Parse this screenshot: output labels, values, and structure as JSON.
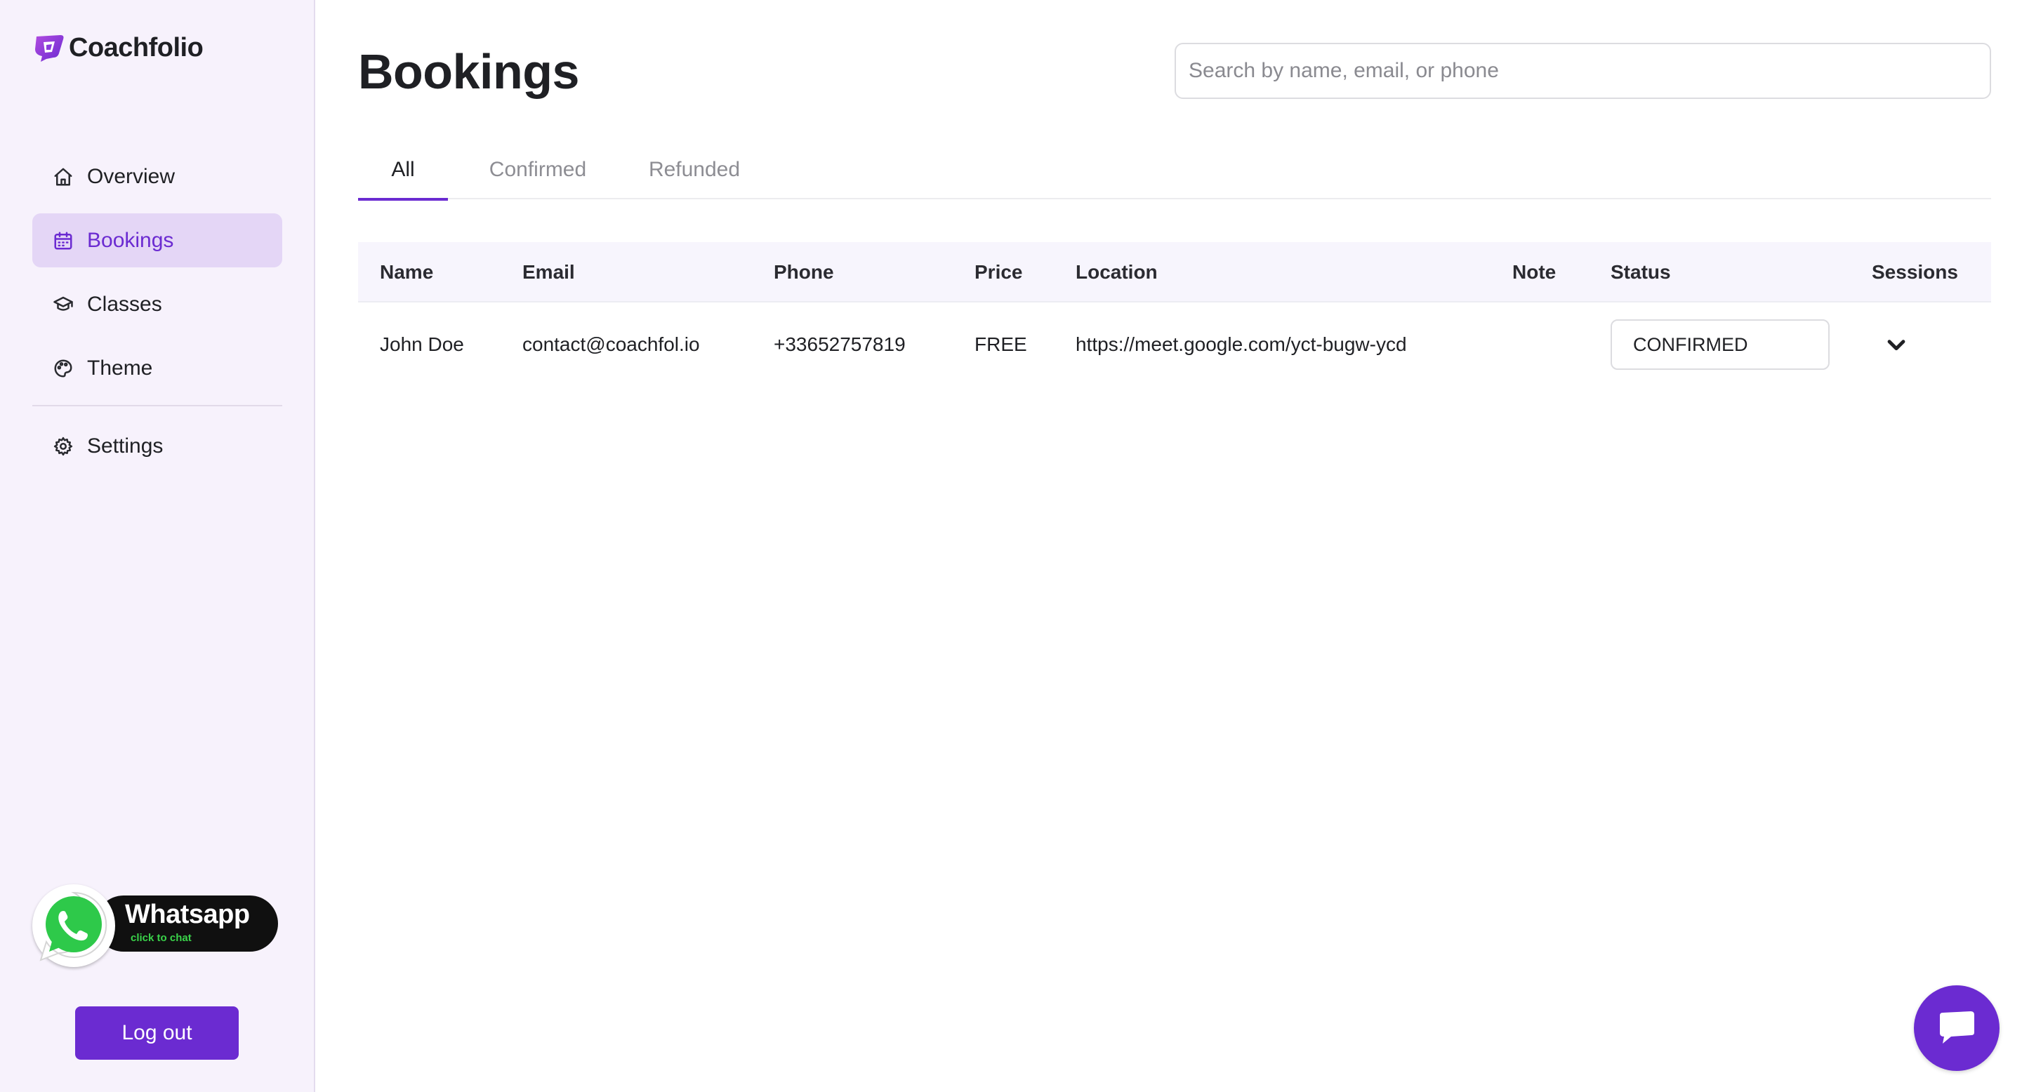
{
  "brand": {
    "name": "Coachfolio",
    "logo_icon": "coachfolio-logo-icon",
    "accent": "#6b2bd1"
  },
  "sidebar": {
    "items": [
      {
        "label": "Overview",
        "icon": "home-icon",
        "active": false
      },
      {
        "label": "Bookings",
        "icon": "calendar-icon",
        "active": true
      },
      {
        "label": "Classes",
        "icon": "graduation-cap-icon",
        "active": false
      },
      {
        "label": "Theme",
        "icon": "palette-icon",
        "active": false
      },
      {
        "label": "Settings",
        "icon": "gear-icon",
        "active": false
      }
    ],
    "whatsapp": {
      "title": "Whatsapp",
      "subtitle": "click to chat"
    },
    "logout_label": "Log out"
  },
  "main": {
    "title": "Bookings",
    "search": {
      "placeholder": "Search by name, email, or phone",
      "value": ""
    },
    "tabs": [
      {
        "label": "All",
        "active": true
      },
      {
        "label": "Confirmed",
        "active": false
      },
      {
        "label": "Refunded",
        "active": false
      }
    ],
    "table": {
      "columns": [
        "Name",
        "Email",
        "Phone",
        "Price",
        "Location",
        "Note",
        "Status",
        "Sessions"
      ],
      "rows": [
        {
          "name": "John Doe",
          "email": "contact@coachfol.io",
          "phone": "+33652757819",
          "price": "FREE",
          "location": "https://meet.google.com/yct-bugw-ycd",
          "note": "",
          "status": "CONFIRMED"
        }
      ]
    }
  },
  "chat_widget": {
    "icon": "chat-bubble-icon"
  }
}
